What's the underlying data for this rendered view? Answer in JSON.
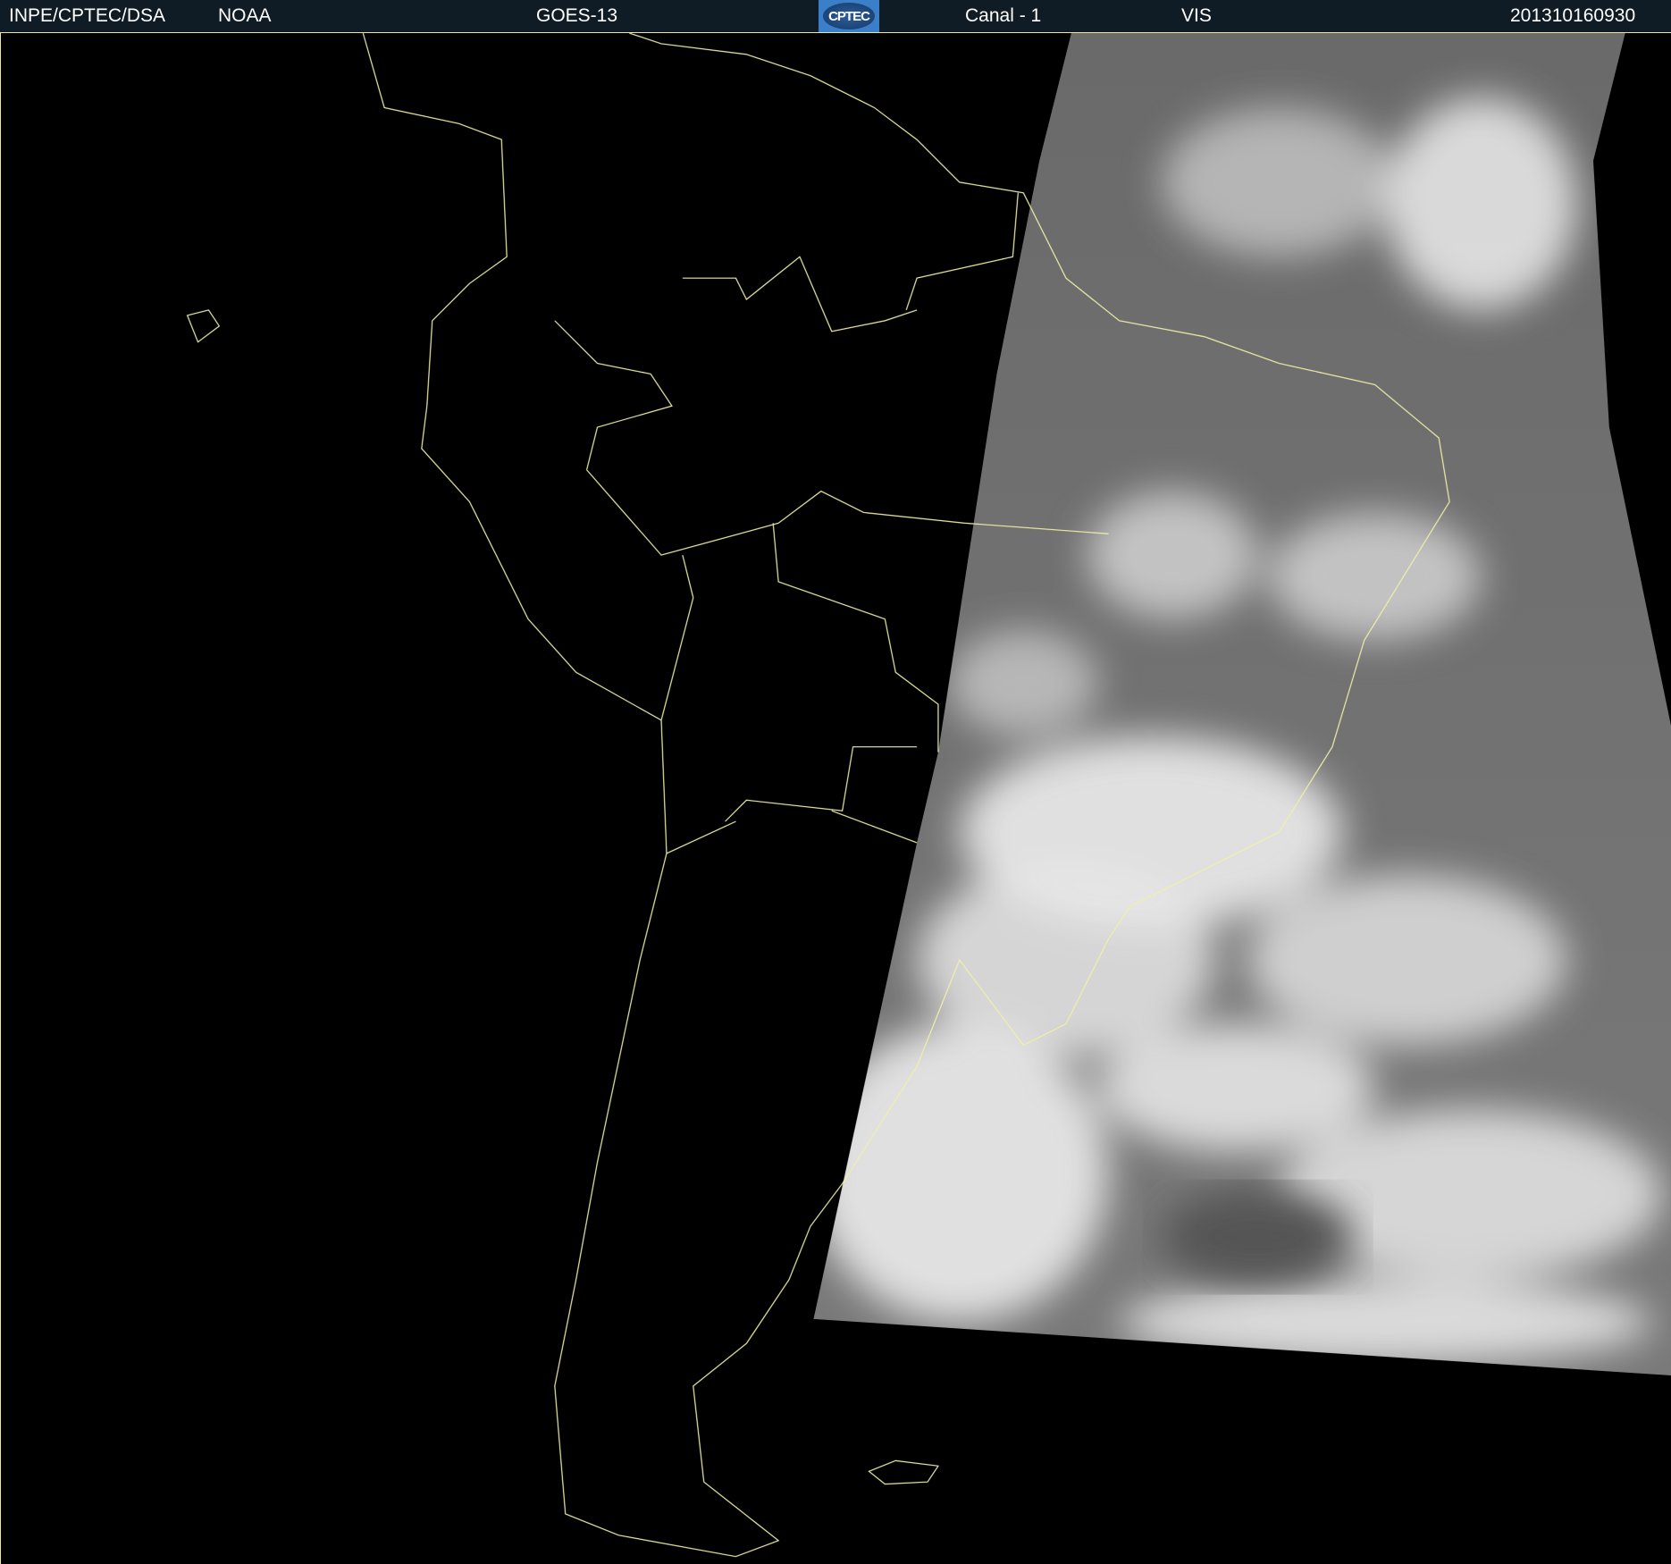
{
  "header": {
    "institution": "INPE/CPTEC/DSA",
    "agency": "NOAA",
    "satellite": "GOES-13",
    "logo_text": "CPTEC",
    "channel": "Canal - 1",
    "band": "VIS",
    "timestamp": "201310160930"
  },
  "colors": {
    "header_bg": "#101c25",
    "border": "#e8e8a0",
    "outline": "#f0f0a8"
  }
}
